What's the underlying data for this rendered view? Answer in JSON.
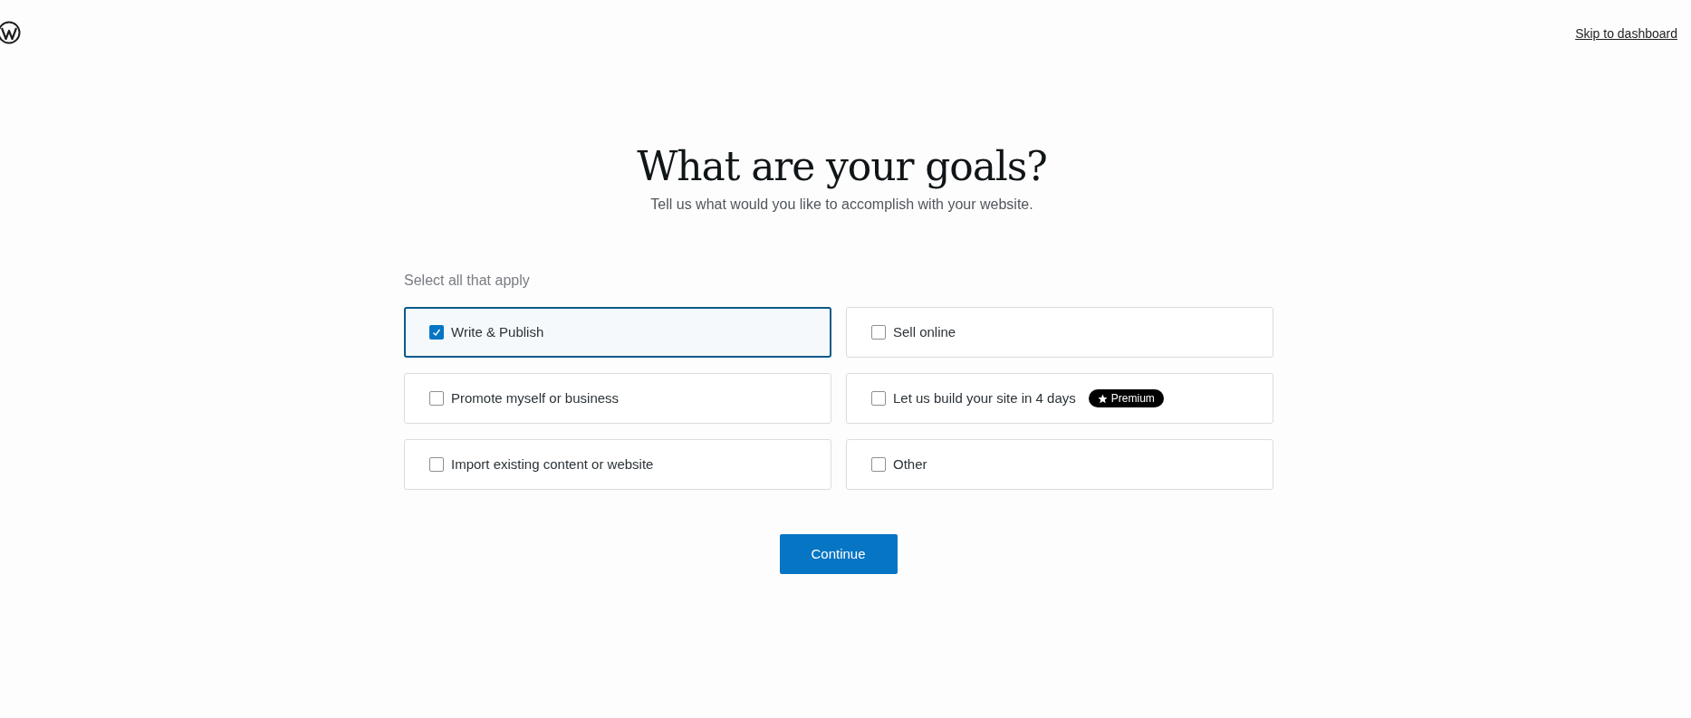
{
  "header": {
    "skip_link": "Skip to dashboard"
  },
  "heading": "What are your goals?",
  "subtitle": "Tell us what would you like to accomplish with your website.",
  "prompt": "Select all that apply",
  "goals": [
    {
      "label": "Write & Publish",
      "checked": true
    },
    {
      "label": "Sell online",
      "checked": false
    },
    {
      "label": "Promote myself or business",
      "checked": false
    },
    {
      "label": "Let us build your site in 4 days",
      "checked": false,
      "badge": "Premium"
    },
    {
      "label": "Import existing content or website",
      "checked": false
    },
    {
      "label": "Other",
      "checked": false
    }
  ],
  "continue_button": "Continue"
}
